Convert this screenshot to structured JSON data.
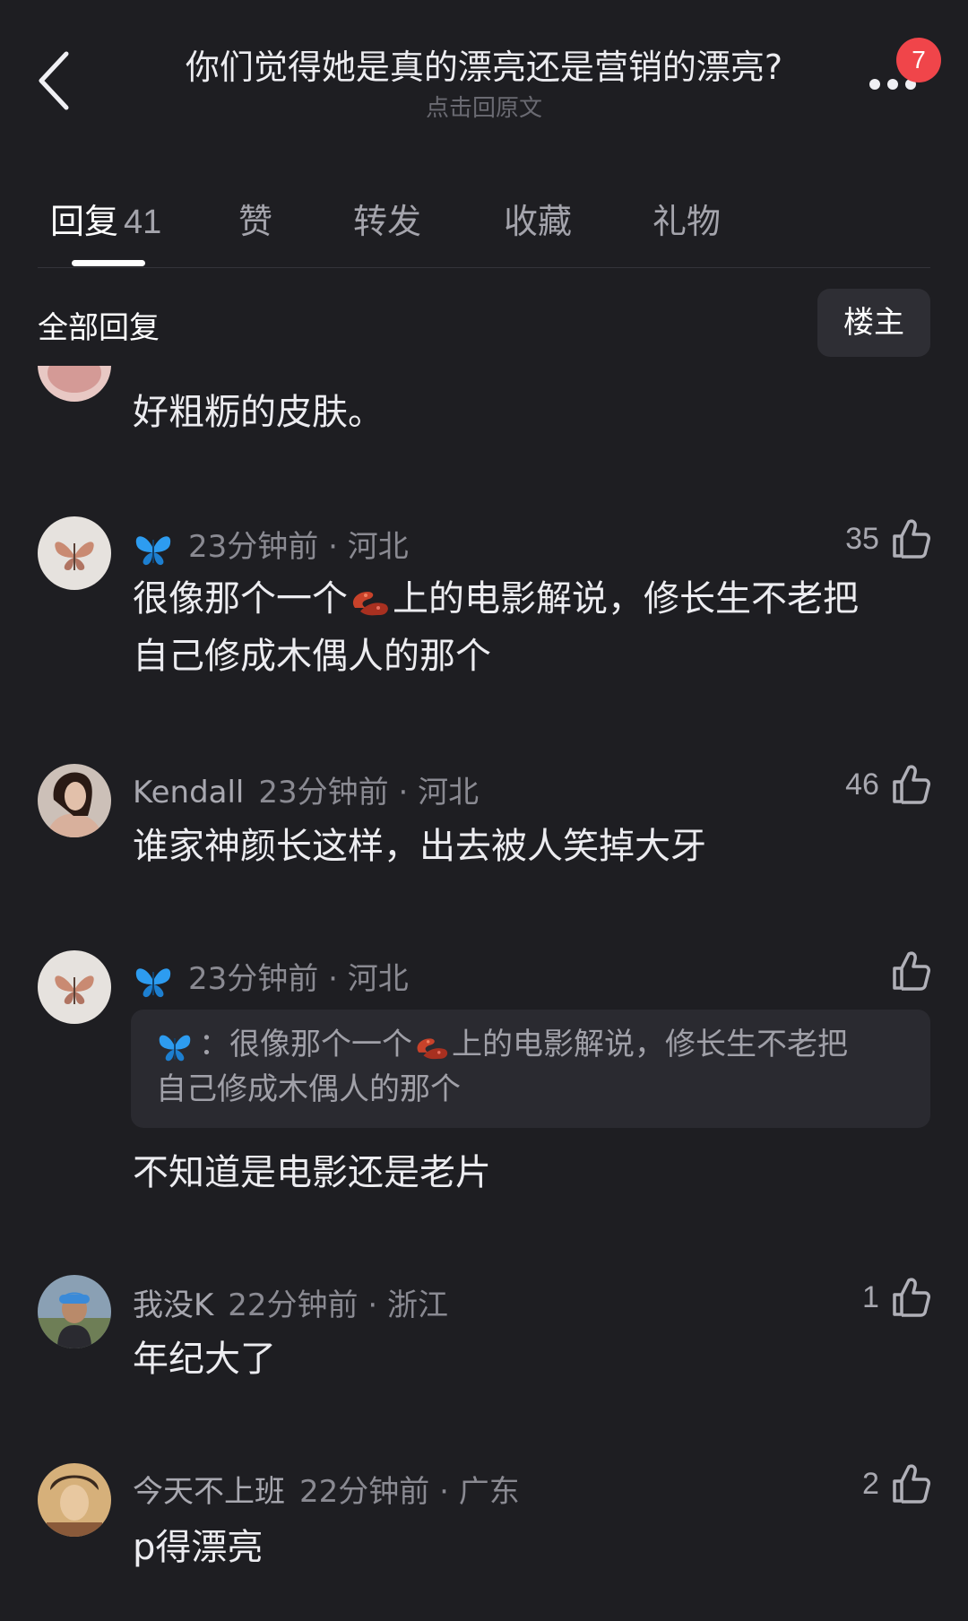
{
  "header": {
    "title": "你们觉得她是真的漂亮还是营销的漂亮?",
    "subtitle": "点击回原文",
    "notification_count": "7",
    "back_icon": "chevron-left-icon",
    "more_icon": "more-dots-icon"
  },
  "tabs": [
    {
      "label": "回复",
      "count": "41"
    },
    {
      "label": "赞"
    },
    {
      "label": "转发"
    },
    {
      "label": "收藏"
    },
    {
      "label": "礼物"
    }
  ],
  "filter": {
    "label": "全部回复",
    "op_button": "楼主"
  },
  "comments": [
    {
      "text": "好粗粝的皮肤。"
    },
    {
      "username_icon": "butterfly-icon",
      "time": "23分钟前",
      "location": "河北",
      "likes": "35",
      "text_part1": "很像那个一个",
      "text_emoji": "sausage-emoji",
      "text_part2": "上的电影解说，修长生不老把",
      "text_line2": "自己修成木偶人的那个"
    },
    {
      "username": "Kendall",
      "time": "23分钟前",
      "location": "河北",
      "likes": "46",
      "text": "谁家神颜长这样，出去被人笑掉大牙"
    },
    {
      "username_icon": "butterfly-icon",
      "time": "23分钟前",
      "location": "河北",
      "likes": "",
      "quote": {
        "sep": "：",
        "text_part1": "很像那个一个",
        "text_part2": "上的电影解说，修长生不老把",
        "text_line2": "自己修成木偶人的那个"
      },
      "text": "不知道是电影还是老片"
    },
    {
      "username": "我没K",
      "time": "22分钟前",
      "location": "浙江",
      "likes": "1",
      "text": "年纪大了"
    },
    {
      "username": "今天不上班",
      "time": "22分钟前",
      "location": "广东",
      "likes": "2",
      "text": "p得漂亮"
    }
  ],
  "colors": {
    "background": "#1e1e22",
    "badge": "#f0454a",
    "butterfly": "#2d9cf0"
  },
  "separator": " · "
}
